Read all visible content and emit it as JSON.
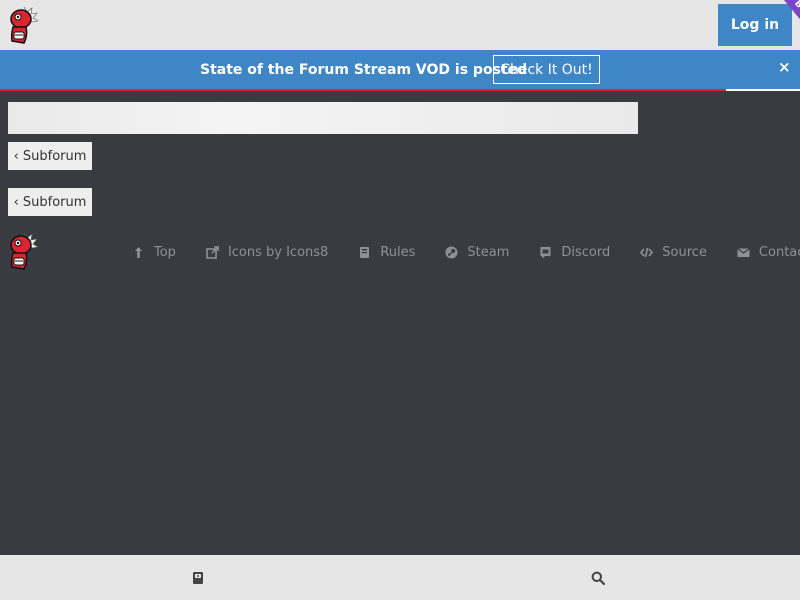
{
  "header": {
    "login_label": "Log in",
    "beta_label": "BETA"
  },
  "announcement": {
    "text": "State of the Forum Stream VOD is posted",
    "button_label": "Check It Out!",
    "close_label": "×"
  },
  "content": {
    "subforum_button_1": "‹ Subforum",
    "subforum_button_2": "‹ Subforum"
  },
  "footer": {
    "links": [
      {
        "label": "Top",
        "icon": "arrow-up-icon"
      },
      {
        "label": "Icons by Icons8",
        "icon": "external-link-icon"
      },
      {
        "label": "Rules",
        "icon": "book-icon"
      },
      {
        "label": "Steam",
        "icon": "steam-icon"
      },
      {
        "label": "Discord",
        "icon": "discord-icon"
      },
      {
        "label": "Source",
        "icon": "code-icon"
      },
      {
        "label": "Contact",
        "icon": "envelope-icon"
      }
    ]
  },
  "bottom_bar": {
    "left_icon": "book-icon",
    "right_icon": "search-icon"
  },
  "colors": {
    "page_background": "#3a3b40",
    "header_background": "#e6e6e6",
    "accent_blue": "#3f86c6",
    "beta_purple": "#7b44c9",
    "progress_red": "#cc2b3a",
    "footer_link_gray": "#8f9096"
  }
}
